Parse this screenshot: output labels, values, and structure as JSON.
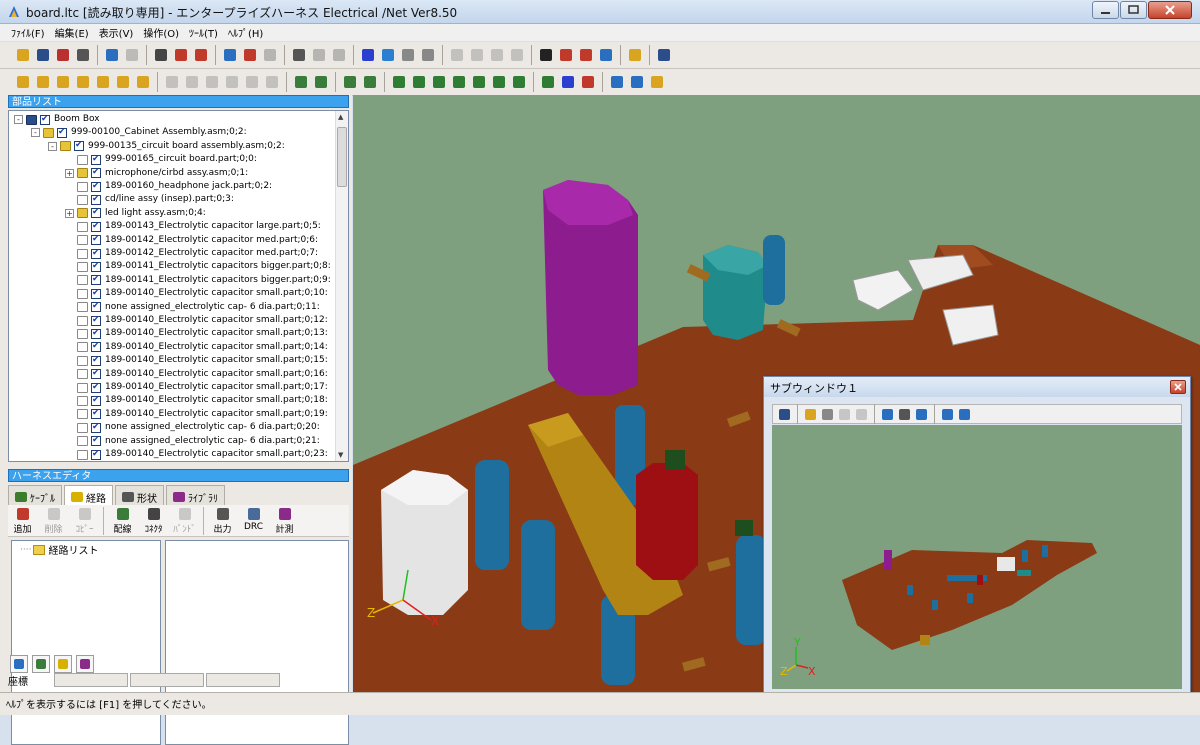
{
  "window": {
    "title": "board.ltc [読み取り専用] - エンタープライズハーネス Electrical /Net Ver8.50"
  },
  "menu": [
    "ﾌｧｲﾙ(F)",
    "編集(E)",
    "表示(V)",
    "操作(O)",
    "ﾂｰﾙ(T)",
    "ﾍﾙﾌﾟ(H)"
  ],
  "parts_panel": {
    "title": "部品リスト",
    "tree": [
      {
        "depth": 0,
        "kind": "root",
        "expander": "-",
        "label": "Boom Box"
      },
      {
        "depth": 1,
        "kind": "asm",
        "expander": "-",
        "label": "999-00100_Cabinet Assembly.asm;0;2:"
      },
      {
        "depth": 2,
        "kind": "asm",
        "expander": "-",
        "label": "999-00135_circuit  board assembly.asm;0;2:"
      },
      {
        "depth": 3,
        "kind": "part",
        "expander": "",
        "label": "999-00165_circuit board.part;0;0:"
      },
      {
        "depth": 3,
        "kind": "asm",
        "expander": "+",
        "label": "microphone/cirbd assy.asm;0;1:"
      },
      {
        "depth": 3,
        "kind": "part",
        "expander": "",
        "label": "189-00160_headphone jack.part;0;2:"
      },
      {
        "depth": 3,
        "kind": "part",
        "expander": "",
        "label": "cd/line assy  (insep).part;0;3:"
      },
      {
        "depth": 3,
        "kind": "asm",
        "expander": "+",
        "label": "led light assy.asm;0;4:"
      },
      {
        "depth": 3,
        "kind": "part",
        "expander": "",
        "label": "189-00143_Electrolytic capacitor large.part;0;5:"
      },
      {
        "depth": 3,
        "kind": "part",
        "expander": "",
        "label": "189-00142_Electrolytic capacitor med.part;0;6:"
      },
      {
        "depth": 3,
        "kind": "part",
        "expander": "",
        "label": "189-00142_Electrolytic capacitor med.part;0;7:"
      },
      {
        "depth": 3,
        "kind": "part",
        "expander": "",
        "label": "189-00141_Electrolytic capacitors bigger.part;0;8:"
      },
      {
        "depth": 3,
        "kind": "part",
        "expander": "",
        "label": "189-00141_Electrolytic capacitors bigger.part;0;9:"
      },
      {
        "depth": 3,
        "kind": "part",
        "expander": "",
        "label": "189-00140_Electrolytic capacitor small.part;0;10:"
      },
      {
        "depth": 3,
        "kind": "part",
        "expander": "",
        "label": "none assigned_electrolytic  cap- 6 dia.part;0;11:"
      },
      {
        "depth": 3,
        "kind": "part",
        "expander": "",
        "label": "189-00140_Electrolytic capacitor small.part;0;12:"
      },
      {
        "depth": 3,
        "kind": "part",
        "expander": "",
        "label": "189-00140_Electrolytic capacitor small.part;0;13:"
      },
      {
        "depth": 3,
        "kind": "part",
        "expander": "",
        "label": "189-00140_Electrolytic capacitor small.part;0;14:"
      },
      {
        "depth": 3,
        "kind": "part",
        "expander": "",
        "label": "189-00140_Electrolytic capacitor small.part;0;15:"
      },
      {
        "depth": 3,
        "kind": "part",
        "expander": "",
        "label": "189-00140_Electrolytic capacitor small.part;0;16:"
      },
      {
        "depth": 3,
        "kind": "part",
        "expander": "",
        "label": "189-00140_Electrolytic capacitor small.part;0;17:"
      },
      {
        "depth": 3,
        "kind": "part",
        "expander": "",
        "label": "189-00140_Electrolytic capacitor small.part;0;18:"
      },
      {
        "depth": 3,
        "kind": "part",
        "expander": "",
        "label": "189-00140_Electrolytic capacitor small.part;0;19:"
      },
      {
        "depth": 3,
        "kind": "part",
        "expander": "",
        "label": "none assigned_electrolytic  cap- 6 dia.part;0;20:"
      },
      {
        "depth": 3,
        "kind": "part",
        "expander": "",
        "label": "none assigned_electrolytic  cap- 6 dia.part;0;21:"
      },
      {
        "depth": 3,
        "kind": "part",
        "expander": "",
        "label": "189-00140_Electrolytic capacitor small.part;0;23:"
      }
    ]
  },
  "harness_panel": {
    "title": "ハーネスエディタ",
    "tabs": [
      {
        "label": "ｹｰﾌﾞﾙ",
        "icon": "cable-icon",
        "color": "#3b7d2c"
      },
      {
        "label": "経路",
        "icon": "route-icon",
        "color": "#d8b000"
      },
      {
        "label": "形状",
        "icon": "shape-icon",
        "color": "#555555"
      },
      {
        "label": "ﾗｲﾌﾞﾗﾘ",
        "icon": "library-icon",
        "color": "#8a2b8a"
      }
    ],
    "buttons": [
      {
        "label": "追加",
        "icon": "add-icon",
        "enabled": true,
        "color": "#c0392b"
      },
      {
        "label": "削除",
        "icon": "delete-icon",
        "enabled": false,
        "color": "#777777"
      },
      {
        "label": "ｺﾋﾟｰ",
        "icon": "copy-icon",
        "enabled": false,
        "color": "#777777"
      },
      {
        "label": "配線",
        "icon": "wiring-icon",
        "enabled": true,
        "color": "#3a7d3a"
      },
      {
        "label": "ｺﾈｸﾀ",
        "icon": "connector-icon",
        "enabled": true,
        "color": "#444444"
      },
      {
        "label": "ﾊﾞﾝﾄﾞ",
        "icon": "band-icon",
        "enabled": false,
        "color": "#777777"
      },
      {
        "label": "出力",
        "icon": "output-icon",
        "enabled": true,
        "color": "#555555"
      },
      {
        "label": "DRC",
        "icon": "drc-icon",
        "enabled": true,
        "color": "#4a6a9a"
      },
      {
        "label": "計測",
        "icon": "measure-icon",
        "enabled": true,
        "color": "#8a2b8a"
      }
    ],
    "route_list_label": "経路リスト",
    "coord_label": "座標"
  },
  "subwindow": {
    "title": "サブウィンドウ１"
  },
  "status": {
    "help_text": "ﾍﾙﾌﾟを表示するには [F1] を押してください。"
  },
  "axes": {
    "x": "X",
    "y": "Y",
    "z": "Z"
  }
}
